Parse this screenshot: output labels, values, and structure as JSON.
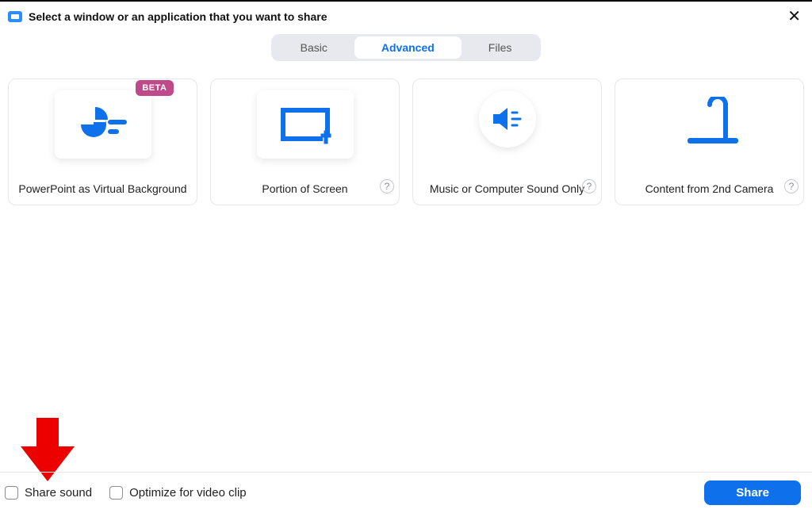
{
  "header": {
    "title": "Select a window or an application that you want to share"
  },
  "tabs": {
    "basic": "Basic",
    "advanced": "Advanced",
    "files": "Files"
  },
  "options": {
    "ppt_vbg": {
      "title": "PowerPoint as Virtual Background",
      "badge": "BETA"
    },
    "portion": {
      "title": "Portion of Screen",
      "help": "?"
    },
    "music": {
      "title": "Music or Computer Sound Only",
      "help": "?"
    },
    "camera": {
      "title": "Content from 2nd Camera",
      "help": "?"
    }
  },
  "footer": {
    "share_sound": "Share sound",
    "optimize_clip": "Optimize for video clip",
    "share_button": "Share"
  },
  "colors": {
    "accent": "#0E71EB",
    "brand_blue": "#2D8CFF",
    "beta_pink": "#BF4A8B",
    "annotation_red": "#EC0000"
  }
}
